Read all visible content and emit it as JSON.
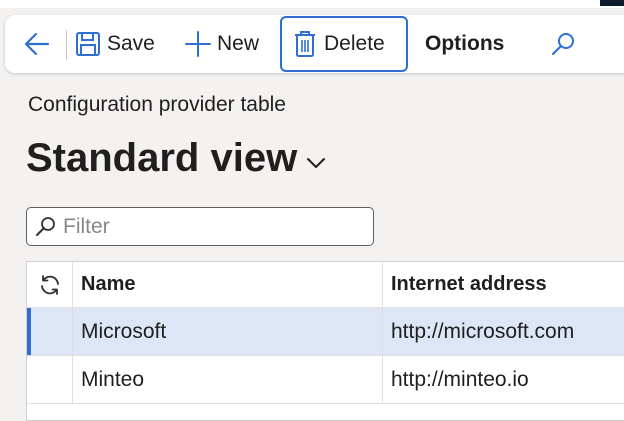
{
  "toolbar": {
    "save_label": "Save",
    "new_label": "New",
    "delete_label": "Delete",
    "options_label": "Options"
  },
  "page": {
    "caption": "Configuration provider table",
    "view_title": "Standard view"
  },
  "filter": {
    "placeholder": "Filter",
    "value": ""
  },
  "grid": {
    "columns": [
      "Name",
      "Internet address"
    ],
    "rows": [
      {
        "name": "Microsoft",
        "address": "http://microsoft.com",
        "selected": true
      },
      {
        "name": "Minteo",
        "address": "http://minteo.io",
        "selected": false
      }
    ]
  },
  "colors": {
    "accent": "#2f6fd2",
    "selected_row": "#dce6f7"
  }
}
